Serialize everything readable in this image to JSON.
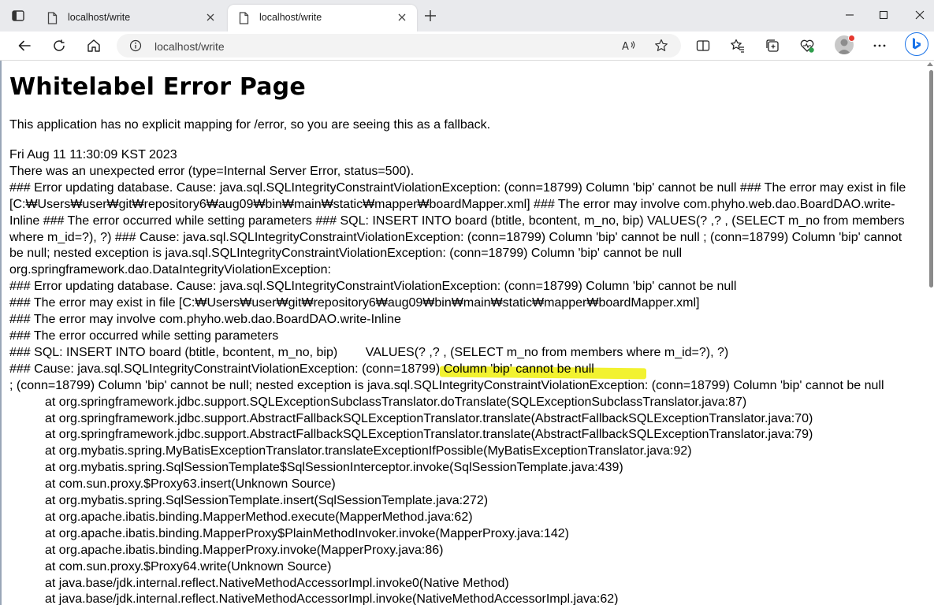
{
  "browser": {
    "tabs": [
      {
        "title": "localhost/write",
        "active": false
      },
      {
        "title": "localhost/write",
        "active": true
      }
    ],
    "address": {
      "url": "localhost/write"
    },
    "icons": {
      "tab_actions": "tab-actions-icon",
      "page": "page-icon",
      "close": "close-icon",
      "new_tab": "plus-icon",
      "minimize": "minimize-icon",
      "maximize": "maximize-icon",
      "window_close": "close-icon",
      "back": "back-arrow-icon",
      "refresh": "refresh-icon",
      "home": "home-icon",
      "info": "info-icon",
      "read_aloud": "read-aloud-icon",
      "favorite": "star-icon",
      "split": "split-screen-icon",
      "favorites": "favorites-icon",
      "collections": "collections-icon",
      "performance": "heart-pulse-icon",
      "menu": "more-icon",
      "copilot": "bing-copilot-icon"
    },
    "accent_color": "#1a73e8"
  },
  "page": {
    "title": "Whitelabel Error Page",
    "message": "This application has no explicit mapping for /error, so you are seeing this as a fallback.",
    "timestamp": "Fri Aug 11 11:30:09 KST 2023",
    "status_line": "There was an unexpected error (type=Internal Server Error, status=500).",
    "summary": "### Error updating database. Cause: java.sql.SQLIntegrityConstraintViolationException: (conn=18799) Column 'bip' cannot be null ### The error may exist in file [C:₩Users₩user₩git₩repository6₩aug09₩bin₩main₩static₩mapper₩boardMapper.xml] ### The error may involve com.phyho.web.dao.BoardDAO.write-Inline ### The error occurred while setting parameters ### SQL: INSERT INTO board (btitle, bcontent, m_no, bip) VALUES(? ,? , (SELECT m_no from members where m_id=?), ?) ### Cause: java.sql.SQLIntegrityConstraintViolationException: (conn=18799) Column 'bip' cannot be null ; (conn=18799) Column 'bip' cannot be null; nested exception is java.sql.SQLIntegrityConstraintViolationException: (conn=18799) Column 'bip' cannot be null",
    "details": [
      "org.springframework.dao.DataIntegrityViolationException:",
      "### Error updating database.  Cause: java.sql.SQLIntegrityConstraintViolationException: (conn=18799) Column 'bip' cannot be null",
      "### The error may exist in file [C:₩Users₩user₩git₩repository6₩aug09₩bin₩main₩static₩mapper₩boardMapper.xml]",
      "### The error may involve com.phyho.web.dao.BoardDAO.write-Inline",
      "### The error occurred while setting parameters",
      "### SQL: INSERT INTO board (btitle, bcontent, m_no, bip)        VALUES(? ,? , (SELECT m_no from members where m_id=?), ?)",
      "### Cause: java.sql.SQLIntegrityConstraintViolationException: (conn=18799) Column 'bip' cannot be null",
      "; (conn=18799) Column 'bip' cannot be null; nested exception is java.sql.SQLIntegrityConstraintViolationException: (conn=18799) Column 'bip' cannot be null"
    ],
    "stack": [
      "at org.springframework.jdbc.support.SQLExceptionSubclassTranslator.doTranslate(SQLExceptionSubclassTranslator.java:87)",
      "at org.springframework.jdbc.support.AbstractFallbackSQLExceptionTranslator.translate(AbstractFallbackSQLExceptionTranslator.java:70)",
      "at org.springframework.jdbc.support.AbstractFallbackSQLExceptionTranslator.translate(AbstractFallbackSQLExceptionTranslator.java:79)",
      "at org.mybatis.spring.MyBatisExceptionTranslator.translateExceptionIfPossible(MyBatisExceptionTranslator.java:92)",
      "at org.mybatis.spring.SqlSessionTemplate$SqlSessionInterceptor.invoke(SqlSessionTemplate.java:439)",
      "at com.sun.proxy.$Proxy63.insert(Unknown Source)",
      "at org.mybatis.spring.SqlSessionTemplate.insert(SqlSessionTemplate.java:272)",
      "at org.apache.ibatis.binding.MapperMethod.execute(MapperMethod.java:62)",
      "at org.apache.ibatis.binding.MapperProxy$PlainMethodInvoker.invoke(MapperProxy.java:142)",
      "at org.apache.ibatis.binding.MapperProxy.invoke(MapperProxy.java:86)",
      "at com.sun.proxy.$Proxy64.write(Unknown Source)",
      "at java.base/jdk.internal.reflect.NativeMethodAccessorImpl.invoke0(Native Method)",
      "at java.base/jdk.internal.reflect.NativeMethodAccessorImpl.invoke(NativeMethodAccessorImpl.java:62)"
    ],
    "highlight_color": "#f2f230"
  }
}
